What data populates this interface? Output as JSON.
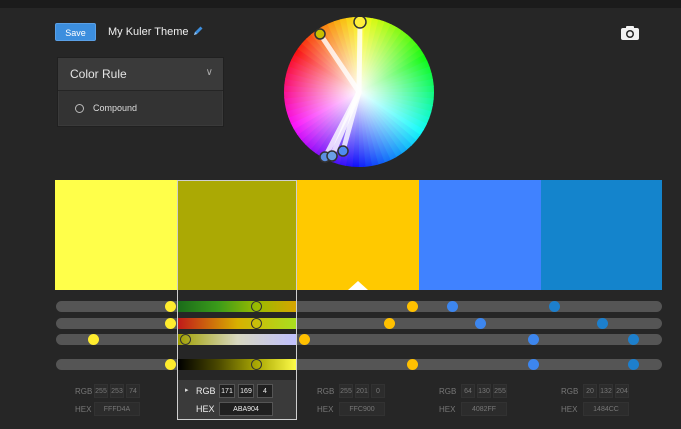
{
  "header": {
    "save_label": "Save",
    "theme_name": "My Kuler Theme"
  },
  "color_rule": {
    "title": "Color Rule",
    "option": "Compound"
  },
  "swatches": [
    {
      "hex": "#FFFF4A",
      "rgb": [
        "255",
        "253",
        "74"
      ],
      "hex_label": "FFFD4A"
    },
    {
      "hex": "#ABA904",
      "rgb": [
        "171",
        "169",
        "4"
      ],
      "hex_label": "ABA904"
    },
    {
      "hex": "#FFC900",
      "rgb": [
        "255",
        "201",
        "0"
      ],
      "hex_label": "FFC900"
    },
    {
      "hex": "#4082FF",
      "rgb": [
        "64",
        "130",
        "255"
      ],
      "hex_label": "4082FF"
    },
    {
      "hex": "#1484CC",
      "rgb": [
        "20",
        "132",
        "204"
      ],
      "hex_label": "1484CC"
    }
  ],
  "labels": {
    "rgb": "RGB",
    "hex": "HEX"
  },
  "selected_index": 1,
  "icons": [
    "pencil-icon",
    "camera-icon",
    "chevron-down-icon",
    "caret-right-icon"
  ],
  "colors": {
    "accent": "#3c8ede",
    "background": "#262626"
  }
}
